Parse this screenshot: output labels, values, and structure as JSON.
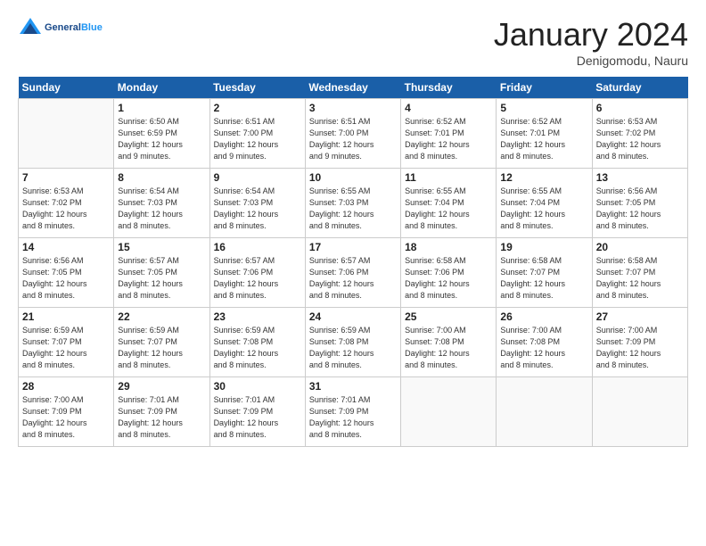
{
  "header": {
    "logo_general": "General",
    "logo_blue": "Blue",
    "month": "January 2024",
    "location": "Denigomodu, Nauru"
  },
  "days_of_week": [
    "Sunday",
    "Monday",
    "Tuesday",
    "Wednesday",
    "Thursday",
    "Friday",
    "Saturday"
  ],
  "weeks": [
    [
      {
        "num": "",
        "detail": ""
      },
      {
        "num": "1",
        "detail": "Sunrise: 6:50 AM\nSunset: 6:59 PM\nDaylight: 12 hours\nand 9 minutes."
      },
      {
        "num": "2",
        "detail": "Sunrise: 6:51 AM\nSunset: 7:00 PM\nDaylight: 12 hours\nand 9 minutes."
      },
      {
        "num": "3",
        "detail": "Sunrise: 6:51 AM\nSunset: 7:00 PM\nDaylight: 12 hours\nand 9 minutes."
      },
      {
        "num": "4",
        "detail": "Sunrise: 6:52 AM\nSunset: 7:01 PM\nDaylight: 12 hours\nand 8 minutes."
      },
      {
        "num": "5",
        "detail": "Sunrise: 6:52 AM\nSunset: 7:01 PM\nDaylight: 12 hours\nand 8 minutes."
      },
      {
        "num": "6",
        "detail": "Sunrise: 6:53 AM\nSunset: 7:02 PM\nDaylight: 12 hours\nand 8 minutes."
      }
    ],
    [
      {
        "num": "7",
        "detail": "Sunrise: 6:53 AM\nSunset: 7:02 PM\nDaylight: 12 hours\nand 8 minutes."
      },
      {
        "num": "8",
        "detail": "Sunrise: 6:54 AM\nSunset: 7:03 PM\nDaylight: 12 hours\nand 8 minutes."
      },
      {
        "num": "9",
        "detail": "Sunrise: 6:54 AM\nSunset: 7:03 PM\nDaylight: 12 hours\nand 8 minutes."
      },
      {
        "num": "10",
        "detail": "Sunrise: 6:55 AM\nSunset: 7:03 PM\nDaylight: 12 hours\nand 8 minutes."
      },
      {
        "num": "11",
        "detail": "Sunrise: 6:55 AM\nSunset: 7:04 PM\nDaylight: 12 hours\nand 8 minutes."
      },
      {
        "num": "12",
        "detail": "Sunrise: 6:55 AM\nSunset: 7:04 PM\nDaylight: 12 hours\nand 8 minutes."
      },
      {
        "num": "13",
        "detail": "Sunrise: 6:56 AM\nSunset: 7:05 PM\nDaylight: 12 hours\nand 8 minutes."
      }
    ],
    [
      {
        "num": "14",
        "detail": "Sunrise: 6:56 AM\nSunset: 7:05 PM\nDaylight: 12 hours\nand 8 minutes."
      },
      {
        "num": "15",
        "detail": "Sunrise: 6:57 AM\nSunset: 7:05 PM\nDaylight: 12 hours\nand 8 minutes."
      },
      {
        "num": "16",
        "detail": "Sunrise: 6:57 AM\nSunset: 7:06 PM\nDaylight: 12 hours\nand 8 minutes."
      },
      {
        "num": "17",
        "detail": "Sunrise: 6:57 AM\nSunset: 7:06 PM\nDaylight: 12 hours\nand 8 minutes."
      },
      {
        "num": "18",
        "detail": "Sunrise: 6:58 AM\nSunset: 7:06 PM\nDaylight: 12 hours\nand 8 minutes."
      },
      {
        "num": "19",
        "detail": "Sunrise: 6:58 AM\nSunset: 7:07 PM\nDaylight: 12 hours\nand 8 minutes."
      },
      {
        "num": "20",
        "detail": "Sunrise: 6:58 AM\nSunset: 7:07 PM\nDaylight: 12 hours\nand 8 minutes."
      }
    ],
    [
      {
        "num": "21",
        "detail": "Sunrise: 6:59 AM\nSunset: 7:07 PM\nDaylight: 12 hours\nand 8 minutes."
      },
      {
        "num": "22",
        "detail": "Sunrise: 6:59 AM\nSunset: 7:07 PM\nDaylight: 12 hours\nand 8 minutes."
      },
      {
        "num": "23",
        "detail": "Sunrise: 6:59 AM\nSunset: 7:08 PM\nDaylight: 12 hours\nand 8 minutes."
      },
      {
        "num": "24",
        "detail": "Sunrise: 6:59 AM\nSunset: 7:08 PM\nDaylight: 12 hours\nand 8 minutes."
      },
      {
        "num": "25",
        "detail": "Sunrise: 7:00 AM\nSunset: 7:08 PM\nDaylight: 12 hours\nand 8 minutes."
      },
      {
        "num": "26",
        "detail": "Sunrise: 7:00 AM\nSunset: 7:08 PM\nDaylight: 12 hours\nand 8 minutes."
      },
      {
        "num": "27",
        "detail": "Sunrise: 7:00 AM\nSunset: 7:09 PM\nDaylight: 12 hours\nand 8 minutes."
      }
    ],
    [
      {
        "num": "28",
        "detail": "Sunrise: 7:00 AM\nSunset: 7:09 PM\nDaylight: 12 hours\nand 8 minutes."
      },
      {
        "num": "29",
        "detail": "Sunrise: 7:01 AM\nSunset: 7:09 PM\nDaylight: 12 hours\nand 8 minutes."
      },
      {
        "num": "30",
        "detail": "Sunrise: 7:01 AM\nSunset: 7:09 PM\nDaylight: 12 hours\nand 8 minutes."
      },
      {
        "num": "31",
        "detail": "Sunrise: 7:01 AM\nSunset: 7:09 PM\nDaylight: 12 hours\nand 8 minutes."
      },
      {
        "num": "",
        "detail": ""
      },
      {
        "num": "",
        "detail": ""
      },
      {
        "num": "",
        "detail": ""
      }
    ]
  ]
}
